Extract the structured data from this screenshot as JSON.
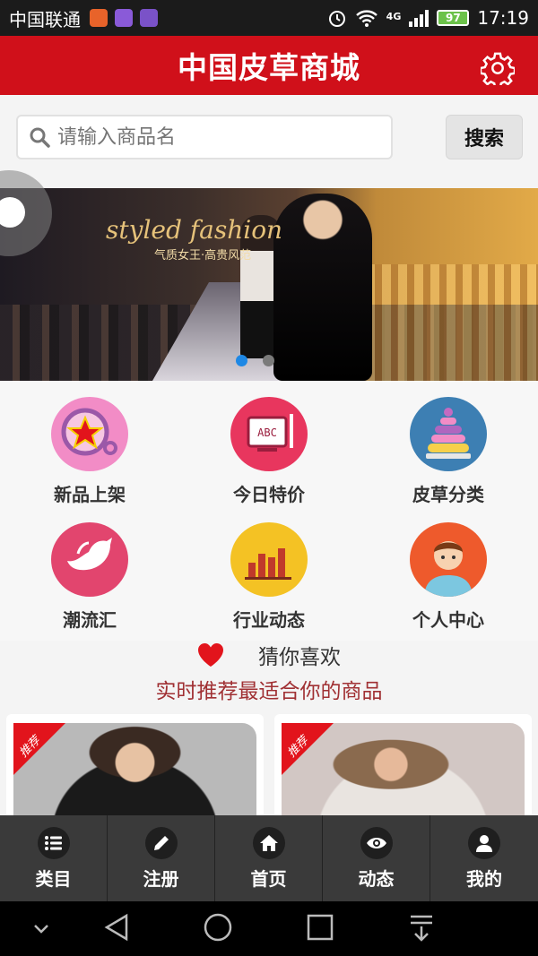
{
  "status_bar": {
    "carrier": "中国联通",
    "network": "4G",
    "battery": "97",
    "time": "17:19"
  },
  "header": {
    "title": "中国皮草商城"
  },
  "search": {
    "placeholder": "请输入商品名",
    "button_label": "搜索"
  },
  "banner": {
    "headline": "styled fashion",
    "subtitle": "气质女王·高贵风范",
    "active_slide": 1,
    "slide_count": 2
  },
  "categories": [
    {
      "label": "新品上架",
      "icon": "star-toy-icon",
      "color": "#f28cc6"
    },
    {
      "label": "今日特价",
      "icon": "abc-board-icon",
      "color": "#e8365e"
    },
    {
      "label": "皮草分类",
      "icon": "ring-stack-icon",
      "color": "#3d7fb3"
    },
    {
      "label": "潮流汇",
      "icon": "bird-icon",
      "color": "#e2456e"
    },
    {
      "label": "行业动态",
      "icon": "bar-chart-icon",
      "color": "#f4c224"
    },
    {
      "label": "个人中心",
      "icon": "person-avatar-icon",
      "color": "#ee5a2c"
    }
  ],
  "recommend": {
    "title": "猜你喜欢",
    "subtitle": "实时推荐最适合你的商品",
    "heart_color": "#e2141c"
  },
  "products": [
    {
      "badge": "推荐"
    },
    {
      "badge": "推荐"
    }
  ],
  "bottom_nav": [
    {
      "label": "类目",
      "icon": "list-icon"
    },
    {
      "label": "注册",
      "icon": "pencil-icon"
    },
    {
      "label": "首页",
      "icon": "home-icon"
    },
    {
      "label": "动态",
      "icon": "eye-icon"
    },
    {
      "label": "我的",
      "icon": "user-icon"
    }
  ],
  "colors": {
    "brand_red": "#d0101a",
    "nav_dark": "#3a3a3a",
    "accent_blue": "#1e88e5"
  }
}
